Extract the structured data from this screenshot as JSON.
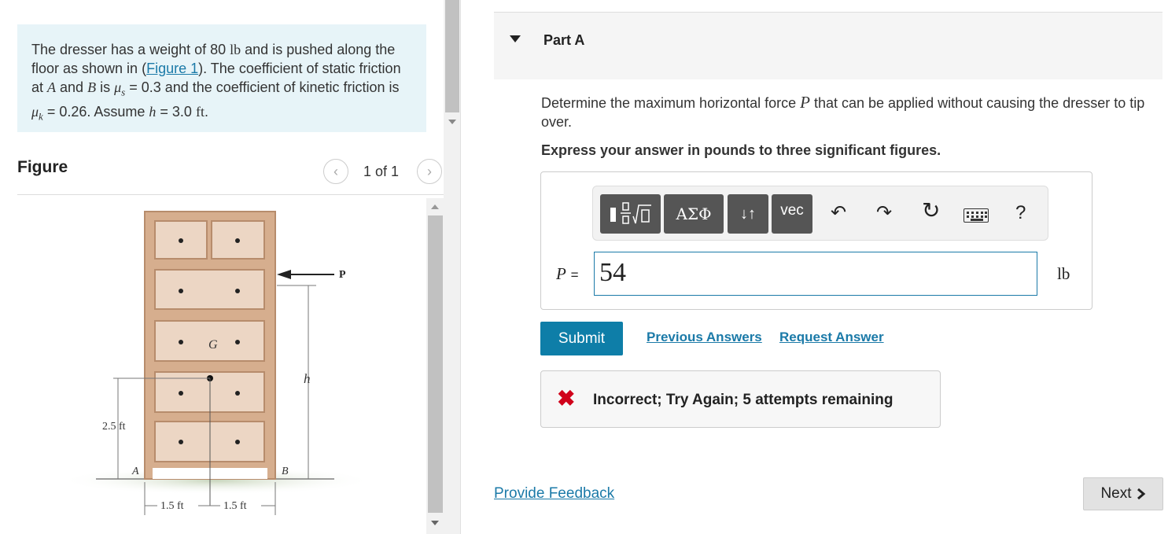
{
  "problem": {
    "text_1": "The dresser has a weight of 80 ",
    "weight_unit": "lb",
    "text_2": " and is pushed along the floor as shown in (",
    "figure_link": "Figure 1",
    "text_3": "). The coefficient of static friction at ",
    "point_a": "A",
    "text_4": " and ",
    "point_b": "B",
    "text_5": " is ",
    "mu_s": "μ",
    "mu_s_sub": "s",
    "text_6": " = 0.3 and the coefficient of kinetic friction is ",
    "mu_k": "μ",
    "mu_k_sub": "k",
    "text_7": " = 0.26. Assume ",
    "h_var": "h",
    "text_8": " = 3.0 ",
    "h_unit": "ft",
    "text_9": "."
  },
  "figure": {
    "title": "Figure",
    "pager": "1 of 1",
    "prev_icon": "chevron-left-icon",
    "next_icon": "chevron-right-icon",
    "labels": {
      "p": "P",
      "g": "G",
      "h": "h",
      "a": "A",
      "b": "B",
      "dim_height": "2.5 ft",
      "dim_left": "1.5 ft",
      "dim_right": "1.5 ft"
    }
  },
  "part": {
    "title": "Part A",
    "question_1": "Determine the maximum horizontal force ",
    "question_var": "P",
    "question_2": " that can be applied without causing the dresser to tip over.",
    "instruction": "Express your answer in pounds to three significant figures."
  },
  "toolbar": {
    "templates_icon": "fraction-sqrt-template-icon",
    "greek_label": "ΑΣΦ",
    "arrows_label": "↓↑",
    "vec_label": "vec",
    "undo_icon": "undo-icon",
    "redo_icon": "redo-icon",
    "reset_icon": "reset-icon",
    "keyboard_icon": "keyboard-icon",
    "help_label": "?"
  },
  "answer": {
    "var_label": "P",
    "equals": "=",
    "value": "54",
    "unit": "lb"
  },
  "actions": {
    "submit": "Submit",
    "previous_answers": "Previous Answers",
    "request_answer": "Request Answer"
  },
  "feedback": {
    "icon": "✖",
    "text": "Incorrect; Try Again; 5 attempts remaining",
    "color": "#d0021b"
  },
  "footer": {
    "provide_feedback": "Provide Feedback",
    "next": "Next",
    "next_icon": "chevron-right-icon"
  }
}
